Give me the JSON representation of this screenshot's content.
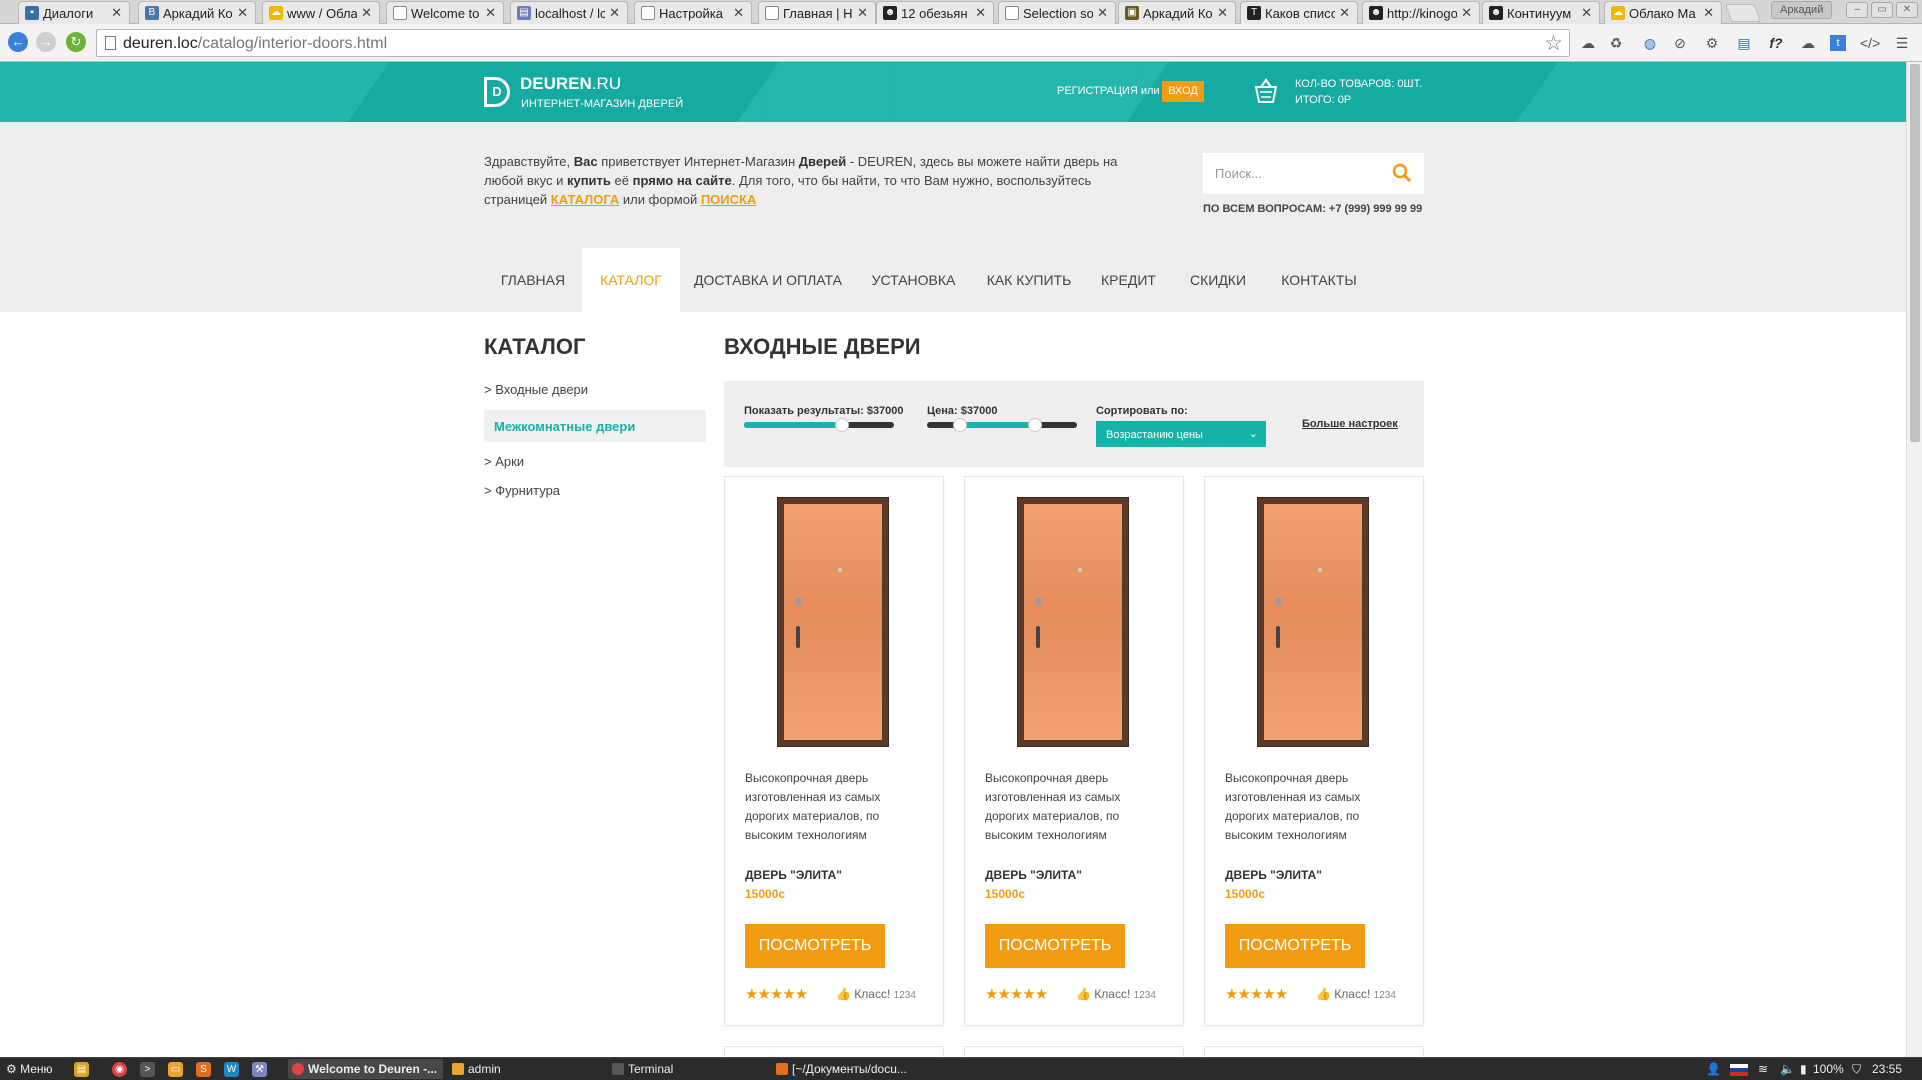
{
  "browser": {
    "tabs": [
      {
        "label": "Диалоги",
        "color": "#3b6ea5"
      },
      {
        "label": "Аркадий Ко",
        "color": "#4a76a8"
      },
      {
        "label": "www / Обла",
        "color": "#f2b705"
      },
      {
        "label": "Welcome to",
        "color": "#888888"
      },
      {
        "label": "localhost / lc",
        "color": "#6c7eb7"
      },
      {
        "label": "Настройка",
        "color": "#888888"
      },
      {
        "label": "Главная | Н",
        "color": "#888888"
      },
      {
        "label": "12 обезьян",
        "color": "#222222"
      },
      {
        "label": "Selection so",
        "color": "#888888"
      },
      {
        "label": "Аркадий Ко",
        "color": "#6b5a20"
      },
      {
        "label": "Каков списо",
        "color": "#222222"
      },
      {
        "label": "http://kinogo",
        "color": "#222222"
      },
      {
        "label": "Континуум",
        "color": "#222222"
      },
      {
        "label": "Облако Ма",
        "color": "#f2b705"
      }
    ],
    "profile": "Аркадий",
    "url_host": "deuren.loc",
    "url_path": "/catalog/interior-doors.html"
  },
  "site": {
    "logo_letter": "D",
    "logo_name": "DEUREN",
    "logo_domain": ".RU",
    "logo_tagline": "ИНТЕРНЕТ-МАГАЗИН ДВЕРЕЙ",
    "auth_text": "РЕГИСТРАЦИЯ или",
    "login_label": "ВХОД",
    "cart_count": "КОЛ-ВО ТОВАРОВ: 0ШТ.",
    "cart_total": "ИТОГО: 0Р",
    "accent": "#17b2a8",
    "orange": "#f39c12"
  },
  "welcome": {
    "p1": "Здравствуйте, ",
    "b1": "Вас",
    "p2": " приветствует Интернет-Магазин ",
    "b2": "Дверей",
    "p3": " - DEUREN, здесь вы можете найти дверь на любой вкус и ",
    "b3": "купить",
    "p4": " её ",
    "b4": "прямо на сайте",
    "p5": ". Для того, что бы найти, то что Вам нужно, воспользуйтесь страницей ",
    "link1": "КАТАЛОГА",
    "p6": " или формой ",
    "link2": "ПОИСКА"
  },
  "search": {
    "placeholder": "Поиск...",
    "phone": "ПО ВСЕМ ВОПРОСАМ: +7 (999) 999 99 99"
  },
  "nav": [
    "ГЛАВНАЯ",
    "КАТАЛОГ",
    "ДОСТАВКА И ОПЛАТА",
    "УСТАНОВКА",
    "КАК КУПИТЬ",
    "КРЕДИТ",
    "СКИДКИ",
    "КОНТАКТЫ"
  ],
  "nav_active": "КАТАЛОГ",
  "sidebar": {
    "title": "КАТАЛОГ",
    "items": [
      "> Входные двери",
      "Межкомнатные двери",
      "> Арки",
      "> Фурнитура"
    ],
    "active": "Межкомнатные двери"
  },
  "page_title": "ВХОДНЫЕ ДВЕРИ",
  "filters": {
    "results_label": "Показать результаты: $37000",
    "results_slider_fraction": 0.65,
    "price_label": "Цена: $37000",
    "price_range_fraction": [
      0.22,
      0.72
    ],
    "sort_label": "Сортировать по:",
    "sort_value": "Возрастанию цены",
    "more_settings": "Больше настроек"
  },
  "products": [
    {
      "desc": "Высокопрочная дверь изготовленная из самых дорогих материалов, по высоким технологиям",
      "name": "ДВЕРЬ \"ЭЛИТА\"",
      "price": "15000с",
      "button": "ПОСМОТРЕТЬ",
      "stars": "★★★★★",
      "like_label": "Класс!",
      "like_count": "1234"
    },
    {
      "desc": "Высокопрочная дверь изготовленная из самых дорогих материалов, по высоким технологиям",
      "name": "ДВЕРЬ \"ЭЛИТА\"",
      "price": "15000с",
      "button": "ПОСМОТРЕТЬ",
      "stars": "★★★★★",
      "like_label": "Класс!",
      "like_count": "1234"
    },
    {
      "desc": "Высокопрочная дверь изготовленная из самых дорогих материалов, по высоким технологиям",
      "name": "ДВЕРЬ \"ЭЛИТА\"",
      "price": "15000с",
      "button": "ПОСМОТРЕТЬ",
      "stars": "★★★★★",
      "like_label": "Класс!",
      "like_count": "1234"
    }
  ],
  "taskbar": {
    "menu": "Меню",
    "windows": [
      "Welcome to Deuren -...",
      "admin",
      "Terminal",
      "[~/Документы/docu..."
    ],
    "active_window": "Welcome to Deuren -...",
    "battery": "100%",
    "time": "23:55"
  }
}
